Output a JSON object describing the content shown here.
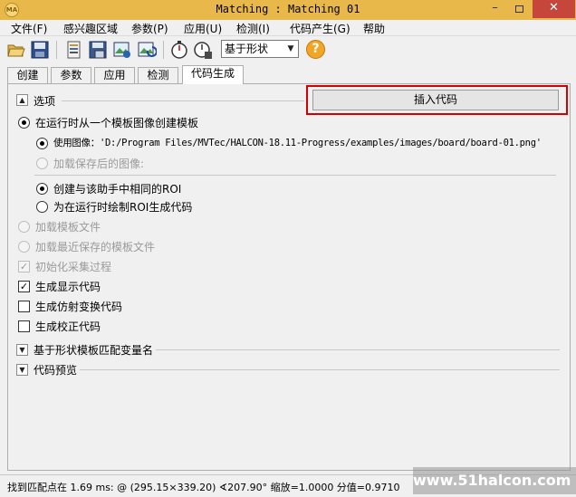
{
  "window": {
    "title": "Matching : Matching 01",
    "icon_label": "MA",
    "minimize_symbol": "–",
    "close_symbol": "✕"
  },
  "menu": [
    {
      "label": "文件(F)"
    },
    {
      "label": "感兴趣区域"
    },
    {
      "label": "参数(P)"
    },
    {
      "label": "应用(U)"
    },
    {
      "label": "检测(I)"
    },
    {
      "label": "代码产生(G)"
    },
    {
      "label": "帮助"
    }
  ],
  "toolbar": {
    "shape_combo_value": "基于形状",
    "combo_arrow": "▼",
    "help_symbol": "?",
    "icons": [
      "open-folder-icon",
      "save-icon",
      "load-image-icon",
      "save-model-icon",
      "image-settings-icon",
      "refresh-image-icon",
      "stopwatch-icon",
      "timer-settings-icon",
      "help-icon"
    ]
  },
  "tabs": [
    {
      "label": "创建",
      "active": false
    },
    {
      "label": "参数",
      "active": false
    },
    {
      "label": "应用",
      "active": false
    },
    {
      "label": "检测",
      "active": false
    },
    {
      "label": "代码生成",
      "active": true
    }
  ],
  "options": {
    "section_title": "选项",
    "collapse_symbol": "▲",
    "expand_symbol": "▼",
    "insert_button": "插入代码",
    "create_from_image": "在运行时从一个模板图像创建模板",
    "use_image": "使用图像：'D:/Program Files/MVTec/HALCON-18.11-Progress/examples/images/board/board-01.png'",
    "load_saved_image": "加载保存后的图像:",
    "create_same_roi": "创建与该助手中相同的ROI",
    "draw_roi_runtime": "为在运行时绘制ROI生成代码",
    "load_model_file": "加载模板文件",
    "load_recent_model": "加载最近保存的模板文件",
    "init_acquisition": "初始化采集过程",
    "gen_display_code": "生成显示代码",
    "gen_affine_code": "生成仿射变换代码",
    "gen_calib_code": "生成校正代码",
    "check_mark": "✓"
  },
  "sections": {
    "variable_names": "基于形状模板匹配变量名",
    "code_preview": "代码预览"
  },
  "status": {
    "text": "找到匹配点在 1.69 ms: @ (295.15×339.20) ∢207.90° 缩放=1.0000 分值=0.9710"
  },
  "watermark": "www.51halcon.com",
  "colors": {
    "titlebar": "#e9b84a",
    "close_button": "#c7463c",
    "highlight_border": "#d40000",
    "help_icon": "#f2a626"
  }
}
